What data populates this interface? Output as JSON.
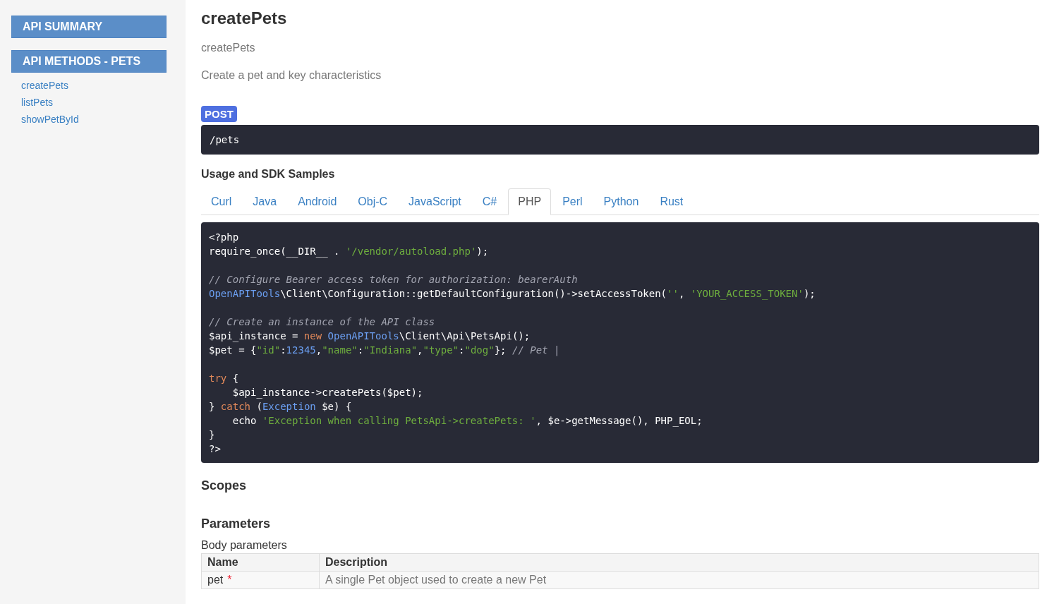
{
  "sidebar": {
    "sections": [
      {
        "title": "API SUMMARY"
      },
      {
        "title": "API METHODS - PETS",
        "links": [
          "createPets",
          "listPets",
          "showPetById"
        ]
      }
    ]
  },
  "method": {
    "title": "createPets",
    "summary": "createPets",
    "description": "Create a pet and key characteristics",
    "http_method": "POST",
    "path": "/pets"
  },
  "samples": {
    "heading": "Usage and SDK Samples",
    "tabs": [
      {
        "label": "Curl",
        "selected": false
      },
      {
        "label": "Java",
        "selected": false
      },
      {
        "label": "Android",
        "selected": false
      },
      {
        "label": "Obj-C",
        "selected": false
      },
      {
        "label": "JavaScript",
        "selected": false
      },
      {
        "label": "C#",
        "selected": false
      },
      {
        "label": "PHP",
        "selected": true
      },
      {
        "label": "Perl",
        "selected": false
      },
      {
        "label": "Python",
        "selected": false
      },
      {
        "label": "Rust",
        "selected": false
      }
    ],
    "code_blocks": [
      {
        "lines": [
          [
            {
              "kind": "plain",
              "text": "<?php"
            }
          ],
          [
            {
              "kind": "plain",
              "text": "require_once(__DIR__ . "
            },
            {
              "kind": "string",
              "text": "'/vendor/autoload.php'"
            },
            {
              "kind": "plain",
              "text": ");"
            }
          ]
        ]
      },
      {
        "lines": [
          [
            {
              "kind": "comment",
              "text": "// Configure Bearer access token for authorization: bearerAuth"
            }
          ],
          [
            {
              "kind": "type",
              "text": "OpenAPITools"
            },
            {
              "kind": "plain",
              "text": "\\Client\\Configuration::getDefaultConfiguration()->setAccessToken("
            },
            {
              "kind": "string",
              "text": "''"
            },
            {
              "kind": "plain",
              "text": ", "
            },
            {
              "kind": "string",
              "text": "'YOUR_ACCESS_TOKEN'"
            },
            {
              "kind": "plain",
              "text": ");"
            }
          ]
        ]
      },
      {
        "lines": [
          [
            {
              "kind": "comment",
              "text": "// Create an instance of the API class"
            }
          ],
          [
            {
              "kind": "plain",
              "text": "$api_instance = "
            },
            {
              "kind": "keyword",
              "text": "new"
            },
            {
              "kind": "type",
              "text": "OpenAPITools"
            },
            {
              "kind": "plain",
              "text": "\\Client\\Api\\PetsApi();"
            }
          ],
          [
            {
              "kind": "plain",
              "text": "$pet = {"
            },
            {
              "kind": "string",
              "text": "\"id\""
            },
            {
              "kind": "plain",
              "text": ":"
            },
            {
              "kind": "number",
              "text": "12345"
            },
            {
              "kind": "plain",
              "text": ","
            },
            {
              "kind": "string",
              "text": "\"name\""
            },
            {
              "kind": "plain",
              "text": ":"
            },
            {
              "kind": "string",
              "text": "\"Indiana\""
            },
            {
              "kind": "plain",
              "text": ","
            },
            {
              "kind": "string",
              "text": "\"type\""
            },
            {
              "kind": "plain",
              "text": ":"
            },
            {
              "kind": "string",
              "text": "\"dog\""
            },
            {
              "kind": "plain",
              "text": "}; "
            },
            {
              "kind": "comment",
              "text": "// Pet |"
            }
          ]
        ]
      },
      {
        "lines": [
          [
            {
              "kind": "keyword",
              "text": "try"
            },
            {
              "kind": "plain",
              "text": " {"
            }
          ],
          [
            {
              "kind": "plain",
              "text": "    $api_instance->createPets($pet);"
            }
          ],
          [
            {
              "kind": "plain",
              "text": "} "
            },
            {
              "kind": "keyword",
              "text": "catch"
            },
            {
              "kind": "plain",
              "text": " ("
            },
            {
              "kind": "type",
              "text": "Exception"
            },
            {
              "kind": "plain",
              "text": " $e) {"
            }
          ],
          [
            {
              "kind": "plain",
              "text": "    echo "
            },
            {
              "kind": "string",
              "text": "'Exception when calling PetsApi->createPets: '"
            },
            {
              "kind": "plain",
              "text": ", $e->getMessage(), PHP_EOL;"
            }
          ],
          [
            {
              "kind": "plain",
              "text": "}"
            }
          ],
          [
            {
              "kind": "plain",
              "text": "?>"
            }
          ]
        ]
      }
    ]
  },
  "scopes": {
    "heading": "Scopes"
  },
  "parameters": {
    "heading": "Parameters",
    "subheading": "Body parameters",
    "columns": [
      "Name",
      "Description"
    ],
    "rows": [
      {
        "name": "pet",
        "required": true,
        "required_mark": "*",
        "description": "A single Pet object used to create a new Pet"
      }
    ]
  }
}
